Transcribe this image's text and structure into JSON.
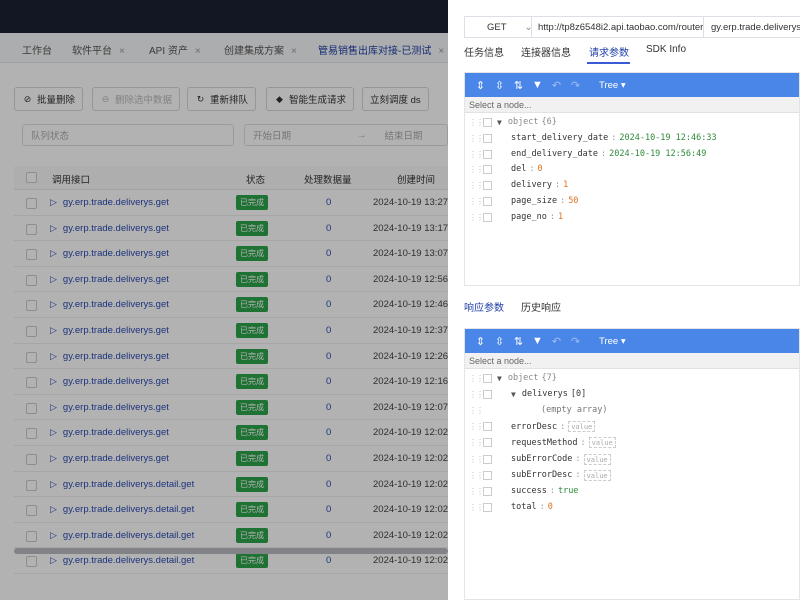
{
  "background": {
    "tabs": [
      {
        "label": "工作台",
        "closable": false
      },
      {
        "label": "软件平台",
        "closable": true
      },
      {
        "label": "API 资产",
        "closable": true
      },
      {
        "label": "创建集成方案",
        "closable": true
      },
      {
        "label": "管易销售出库对接-已测试",
        "closable": true,
        "active": true
      }
    ],
    "actions": [
      {
        "label": "批量删除",
        "icon": "⊘",
        "disabled": false
      },
      {
        "label": "删除选中数据",
        "icon": "⊖",
        "disabled": true
      },
      {
        "label": "重新排队",
        "icon": "↻",
        "disabled": false
      },
      {
        "label": "智能生成请求",
        "icon": "◆",
        "disabled": false
      },
      {
        "label": "立刻调度 ds",
        "icon": "",
        "disabled": false
      }
    ],
    "filters": {
      "queue_status_placeholder": "队列状态",
      "start_date_placeholder": "开始日期",
      "date_arrow": "→",
      "end_date_placeholder": "结束日期"
    },
    "columns": [
      "调用接口",
      "状态",
      "处理数据量",
      "创建时间"
    ],
    "rows": [
      {
        "api": "gy.erp.trade.deliverys.get",
        "status": "已完成",
        "count": "0",
        "time": "2024-10-19 13:27:"
      },
      {
        "api": "gy.erp.trade.deliverys.get",
        "status": "已完成",
        "count": "0",
        "time": "2024-10-19 13:17:"
      },
      {
        "api": "gy.erp.trade.deliverys.get",
        "status": "已完成",
        "count": "0",
        "time": "2024-10-19 13:07:"
      },
      {
        "api": "gy.erp.trade.deliverys.get",
        "status": "已完成",
        "count": "0",
        "time": "2024-10-19 12:56:"
      },
      {
        "api": "gy.erp.trade.deliverys.get",
        "status": "已完成",
        "count": "0",
        "time": "2024-10-19 12:46:"
      },
      {
        "api": "gy.erp.trade.deliverys.get",
        "status": "已完成",
        "count": "0",
        "time": "2024-10-19 12:37:"
      },
      {
        "api": "gy.erp.trade.deliverys.get",
        "status": "已完成",
        "count": "0",
        "time": "2024-10-19 12:26:"
      },
      {
        "api": "gy.erp.trade.deliverys.get",
        "status": "已完成",
        "count": "0",
        "time": "2024-10-19 12:16:"
      },
      {
        "api": "gy.erp.trade.deliverys.get",
        "status": "已完成",
        "count": "0",
        "time": "2024-10-19 12:07:"
      },
      {
        "api": "gy.erp.trade.deliverys.get",
        "status": "已完成",
        "count": "0",
        "time": "2024-10-19 12:02:"
      },
      {
        "api": "gy.erp.trade.deliverys.get",
        "status": "已完成",
        "count": "0",
        "time": "2024-10-19 12:02:"
      },
      {
        "api": "gy.erp.trade.deliverys.detail.get",
        "status": "已完成",
        "count": "0",
        "time": "2024-10-19 12:02:"
      },
      {
        "api": "gy.erp.trade.deliverys.detail.get",
        "status": "已完成",
        "count": "0",
        "time": "2024-10-19 12:02:"
      },
      {
        "api": "gy.erp.trade.deliverys.detail.get",
        "status": "已完成",
        "count": "0",
        "time": "2024-10-19 12:02:"
      },
      {
        "api": "gy.erp.trade.deliverys.detail.get",
        "status": "已完成",
        "count": "0",
        "time": "2024-10-19 12:02:"
      }
    ]
  },
  "panel": {
    "method": "GET",
    "url": "http://tp8z6548i2.api.taobao.com/router",
    "api_name": "gy.erp.trade.deliverys.get",
    "tabs": [
      {
        "label": "任务信息",
        "active": false
      },
      {
        "label": "连接器信息",
        "active": false
      },
      {
        "label": "请求参数",
        "active": true
      },
      {
        "label": "SDK Info",
        "active": false
      }
    ],
    "editor_mode": "Tree",
    "search_placeholder": "Select a node...",
    "request_tree": [
      {
        "depth": 0,
        "key": "object",
        "value": "{6}",
        "type": "obj"
      },
      {
        "depth": 1,
        "key": "start_delivery_date",
        "value": "2024-10-19 12:46:33",
        "type": "str"
      },
      {
        "depth": 1,
        "key": "end_delivery_date",
        "value": "2024-10-19 12:56:49",
        "type": "str"
      },
      {
        "depth": 1,
        "key": "del",
        "value": "0",
        "type": "num"
      },
      {
        "depth": 1,
        "key": "delivery",
        "value": "1",
        "type": "num"
      },
      {
        "depth": 1,
        "key": "page_size",
        "value": "50",
        "type": "num"
      },
      {
        "depth": 1,
        "key": "page_no",
        "value": "1",
        "type": "num"
      }
    ],
    "response_tabs": [
      {
        "label": "响应参数",
        "active": true
      },
      {
        "label": "历史响应",
        "active": false
      }
    ],
    "response_tree": [
      {
        "depth": 0,
        "key": "object",
        "value": "{7}",
        "type": "obj"
      },
      {
        "depth": 1,
        "key": "deliverys",
        "value": "[0]",
        "type": "arr"
      },
      {
        "depth": 2,
        "key": "",
        "value": "(empty array)",
        "type": "empty"
      },
      {
        "depth": 1,
        "key": "errorDesc",
        "value": "value",
        "type": "ph"
      },
      {
        "depth": 1,
        "key": "requestMethod",
        "value": "value",
        "type": "ph"
      },
      {
        "depth": 1,
        "key": "subErrorCode",
        "value": "value",
        "type": "ph"
      },
      {
        "depth": 1,
        "key": "subErrorDesc",
        "value": "value",
        "type": "ph"
      },
      {
        "depth": 1,
        "key": "success",
        "value": "true",
        "type": "bool"
      },
      {
        "depth": 1,
        "key": "total",
        "value": "0",
        "type": "num"
      }
    ]
  },
  "colors": {
    "accent": "#4a86e8",
    "badge": "#2ba44a",
    "link": "#2a4bb3",
    "string": "#2e8b3a",
    "number": "#e1701b"
  }
}
